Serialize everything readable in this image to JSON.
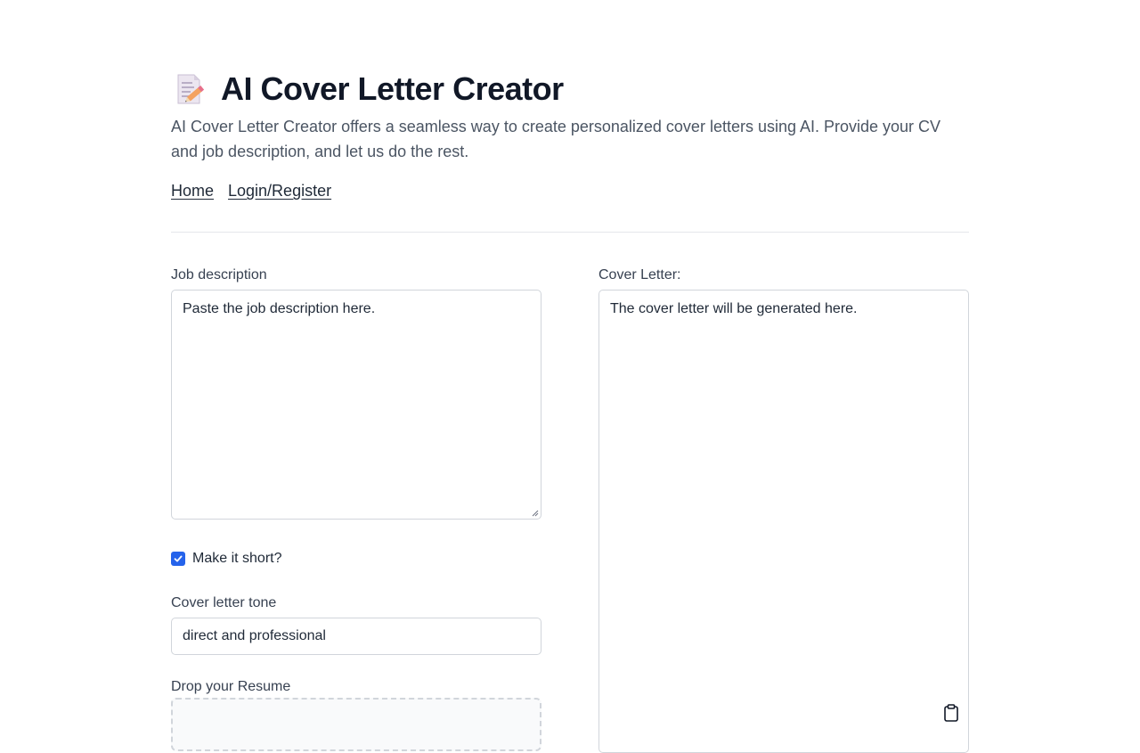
{
  "header": {
    "icon": "memo-icon",
    "title": "AI Cover Letter Creator",
    "subtitle": "AI Cover Letter Creator offers a seamless way to create personalized cover letters using AI. Provide your CV and job description, and let us do the rest."
  },
  "nav": {
    "home": "Home",
    "login": "Login/Register"
  },
  "form": {
    "job_description_label": "Job description",
    "job_description_placeholder": "Paste the job description here.",
    "short_label": "Make it short?",
    "short_checked": true,
    "tone_label": "Cover letter tone",
    "tone_value": "direct and professional",
    "resume_label": "Drop your Resume"
  },
  "output": {
    "cover_letter_label": "Cover Letter:",
    "cover_letter_placeholder": "The cover letter will be generated here.",
    "copy_icon": "clipboard-icon"
  },
  "colors": {
    "accent": "#2563eb",
    "text": "#111827",
    "muted": "#4b5563",
    "border": "#d1d5db"
  }
}
